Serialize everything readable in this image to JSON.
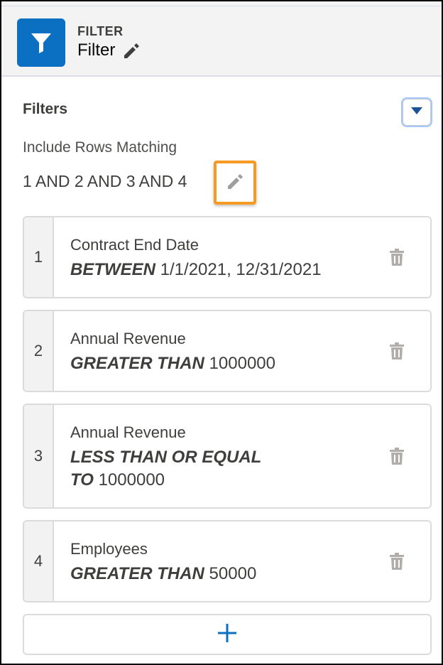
{
  "header": {
    "eyebrow": "FILTER",
    "title": "Filter",
    "icon": "filter-icon",
    "tile_color": "#0b6fc2"
  },
  "filters_section": {
    "title": "Filters",
    "logic_label": "Include Rows Matching",
    "logic_value": "1 AND 2 AND 3 AND 4",
    "highlight_color": "#f59a23"
  },
  "filters": [
    {
      "index": "1",
      "field": "Contract End Date",
      "operator": "BETWEEN",
      "value": " 1/1/2021, 12/31/2021"
    },
    {
      "index": "2",
      "field": "Annual Revenue",
      "operator": "GREATER THAN",
      "value": " 1000000"
    },
    {
      "index": "3",
      "field": "Annual Revenue",
      "operator_line1": "LESS THAN OR EQUAL",
      "operator_line2": "TO",
      "value": " 1000000"
    },
    {
      "index": "4",
      "field": "Employees",
      "operator": "GREATER THAN",
      "value": " 50000"
    }
  ],
  "add_button": {
    "icon": "plus-icon",
    "color": "#0b6fc2"
  }
}
